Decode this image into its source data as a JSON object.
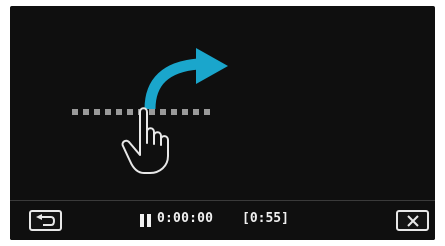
{
  "playback": {
    "current_time": "0:00:00",
    "total_duration": "[0:55]",
    "state": "paused"
  },
  "gesture_hint": {
    "type": "drag-arc-right",
    "arrow_color": "#1aa6cc",
    "track_dot_color": "#9a9a9a"
  },
  "icons": {
    "back": "return-arrow-icon",
    "close": "close-icon",
    "pause": "pause-icon",
    "hand": "pointing-hand-icon"
  }
}
